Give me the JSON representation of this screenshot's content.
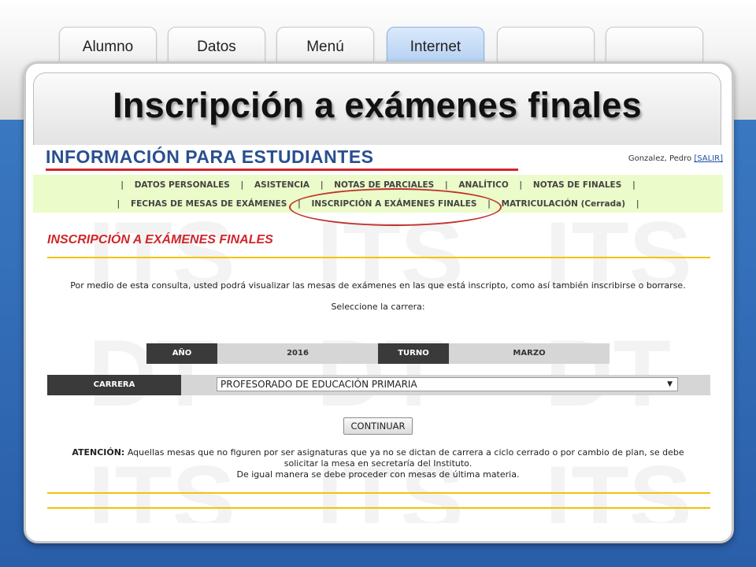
{
  "tabs": [
    {
      "label": "Alumno",
      "active": false
    },
    {
      "label": "Datos",
      "active": false
    },
    {
      "label": "Menú",
      "active": false
    },
    {
      "label": "Internet",
      "active": true
    },
    {
      "label": "",
      "active": false
    },
    {
      "label": "",
      "active": false
    }
  ],
  "slide_title": "Inscripción a exámenes finales",
  "site": {
    "header": "INFORMACIÓN PARA ESTUDIANTES",
    "user": "Gonzalez, Pedro",
    "logout": "[SALIR]",
    "watermark": [
      "ITS",
      "DT"
    ]
  },
  "menu": {
    "row1": [
      "DATOS PERSONALES",
      "ASISTENCIA",
      "NOTAS DE PARCIALES",
      "ANALÍTICO",
      "NOTAS DE FINALES"
    ],
    "row2": [
      "FECHAS DE MESAS DE EXÁMENES",
      "INSCRIPCIÓN A EXÁMENES FINALES",
      "MATRICULACIÓN  (Cerrada)"
    ],
    "separator": "|"
  },
  "section_title": "INSCRIPCIÓN A EXÁMENES FINALES",
  "description": "Por medio de esta consulta, usted podrá visualizar las mesas de exámenes en las que está inscripto, como así también inscribirse o borrarse.",
  "select_prompt": "Seleccione la carrera:",
  "form": {
    "year_label": "AÑO",
    "year_value": "2016",
    "turn_label": "TURNO",
    "turn_value": "MARZO",
    "career_label": "CARRERA",
    "career_value": "PROFESORADO DE EDUCACIÓN PRIMARIA",
    "continue_label": "CONTINUAR"
  },
  "attention": {
    "label": "ATENCIÓN:",
    "line1": " Aquellas mesas que no figuren por ser asignaturas que ya no se dictan de carrera a ciclo cerrado o por cambio de plan, se debe",
    "line2": "solicitar la mesa en secretaría del Instituto.",
    "line3": "De igual manera se debe proceder con mesas de última materia."
  },
  "colors": {
    "accent_red": "#d0262b",
    "header_blue": "#2a4f8f",
    "menu_bg": "#ebfbc9",
    "yellow_rule": "#f2c20a",
    "blue_bg": "#2a5ea8"
  }
}
